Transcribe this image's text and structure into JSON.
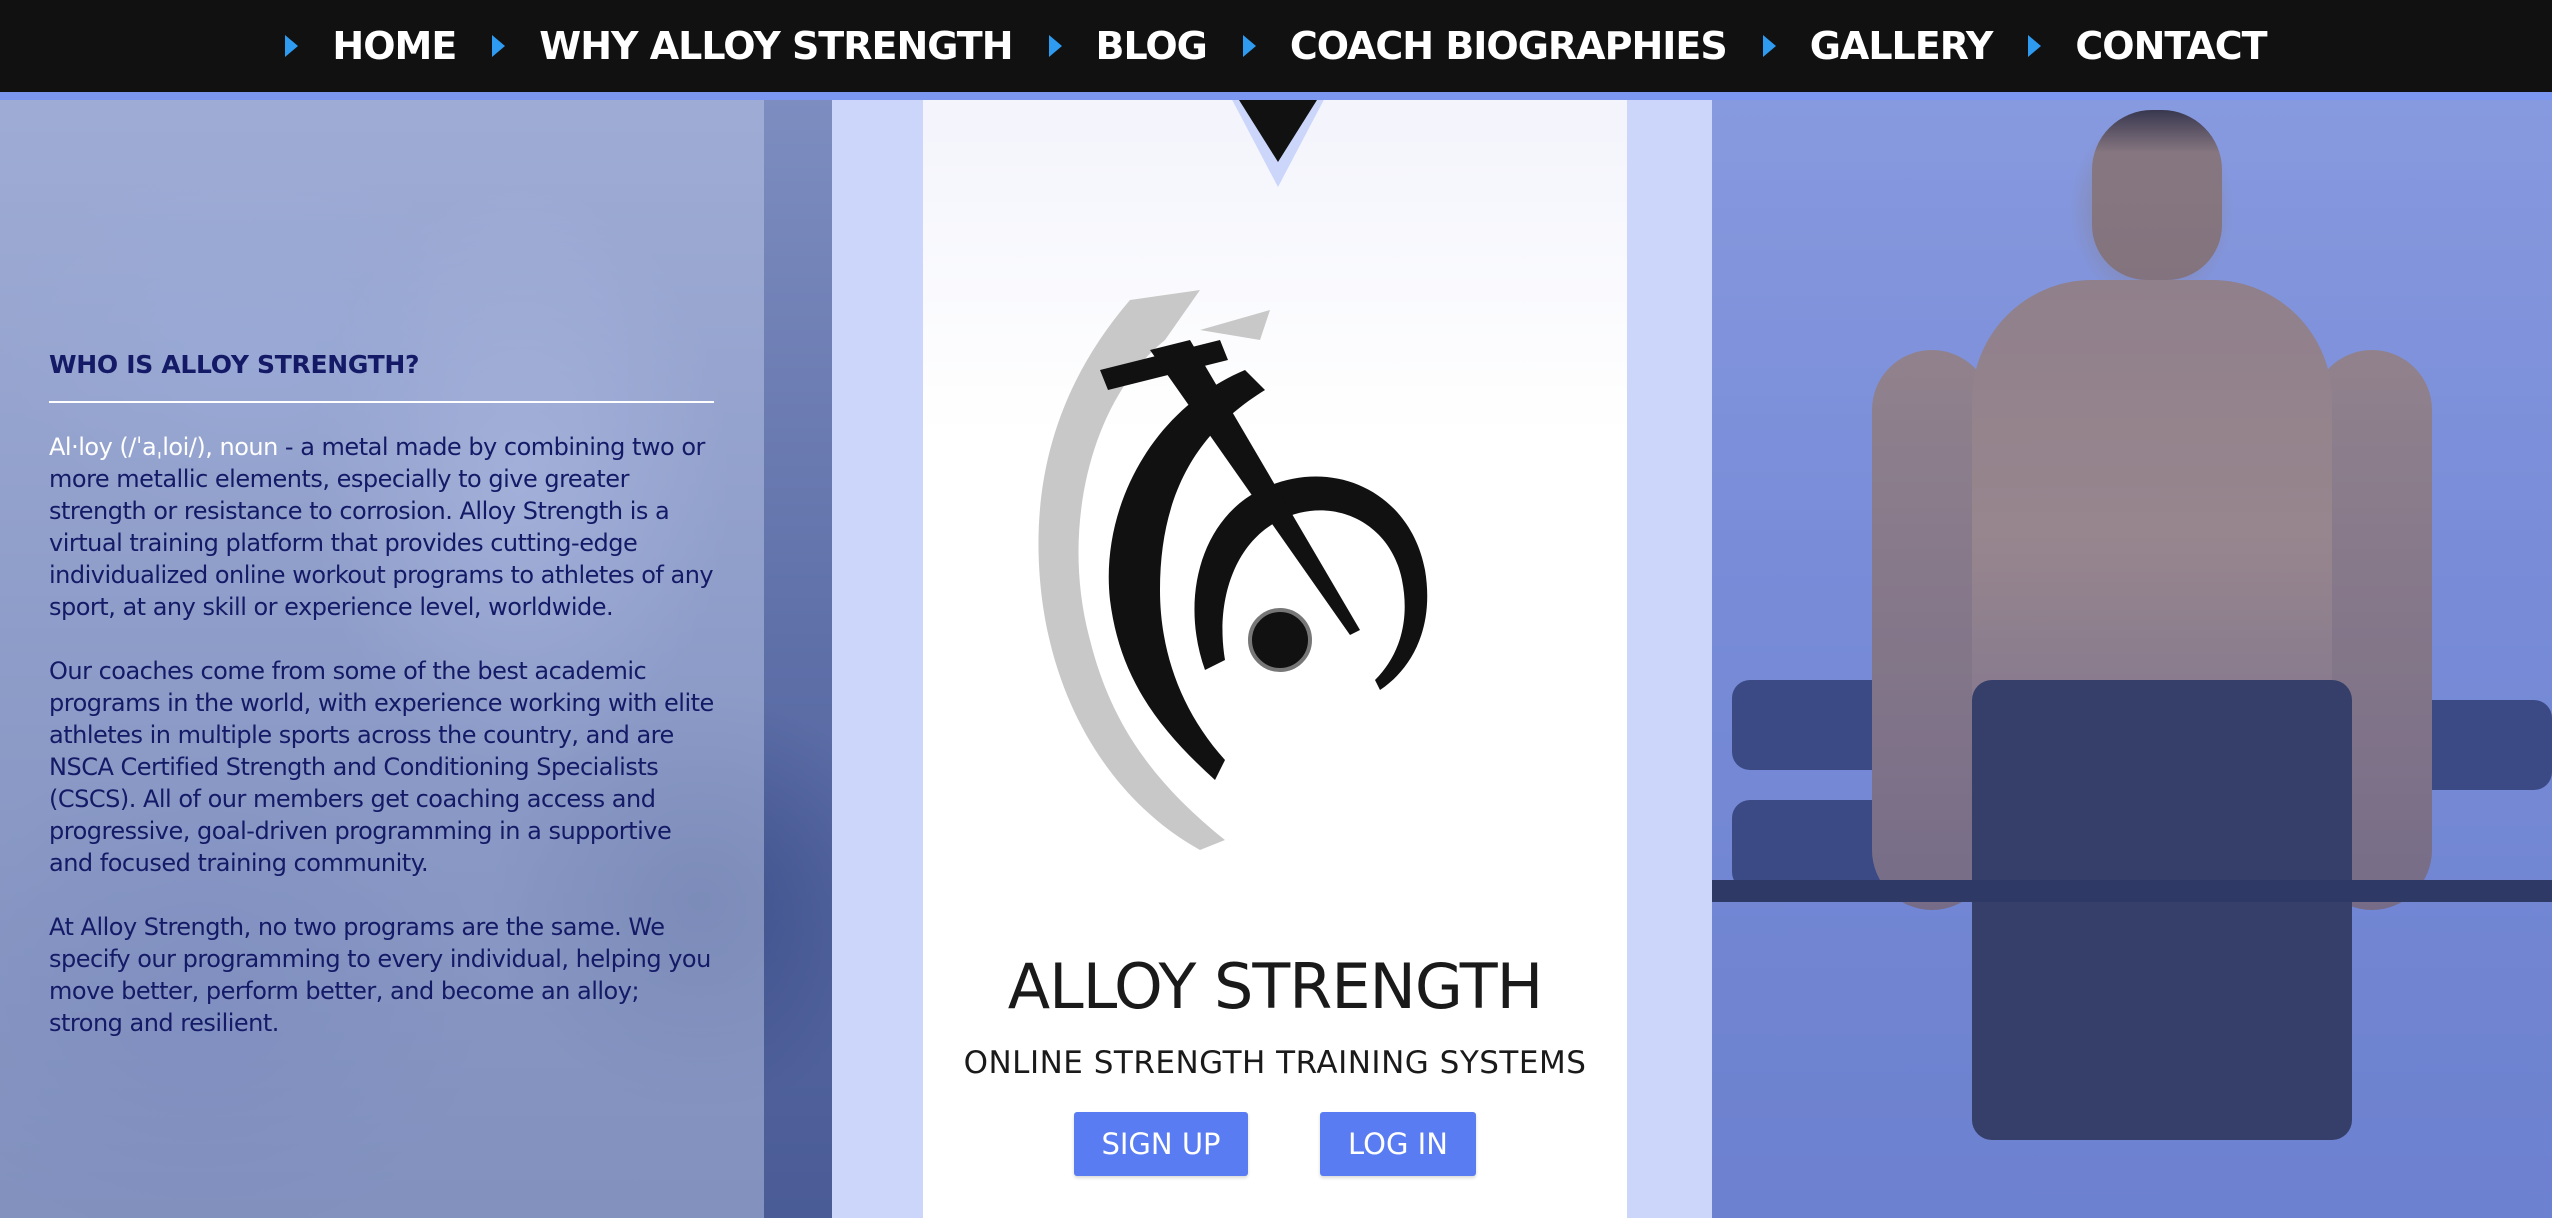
{
  "nav": {
    "items": [
      {
        "label": "HOME"
      },
      {
        "label": "WHY ALLOY STRENGTH"
      },
      {
        "label": "BLOG"
      },
      {
        "label": "COACH BIOGRAPHIES"
      },
      {
        "label": "GALLERY"
      },
      {
        "label": "CONTACT"
      }
    ]
  },
  "about": {
    "heading": "WHO IS ALLOY STRENGTH?",
    "term": "Al·loy (/ˈaˌloi/), noun",
    "definition": " - a metal made by combining two or more metallic elements, especially to give greater strength or resistance to corrosion. Alloy Strength is a virtual training platform that provides cutting-edge individualized online workout programs to athletes of any sport, at any skill or experience level, worldwide.",
    "paragraph2": "Our coaches come from some of the best academic programs in the world, with experience working with elite athletes in multiple sports across the country, and are NSCA Certified Strength and Conditioning Specialists (CSCS). All of our members get coaching access and progressive, goal-driven programming in a supportive and focused training community.",
    "paragraph3": "At Alloy Strength, no two programs are the same. We specify our programming to every individual, helping you move better, perform better, and become an alloy; strong and resilient."
  },
  "brand": {
    "title": "ALLOY STRENGTH",
    "subtitle": "ONLINE STRENGTH TRAINING SYSTEMS",
    "signup_label": "SIGN UP",
    "login_label": "LOG IN"
  },
  "colors": {
    "nav_bg": "#111111",
    "nav_arrow": "#2e9bf0",
    "button": "#5a7cf2",
    "text_dark": "#141a66"
  },
  "icons": {
    "nav_arrow": "play-arrow-icon",
    "logo": "alloy-strength-logo"
  }
}
